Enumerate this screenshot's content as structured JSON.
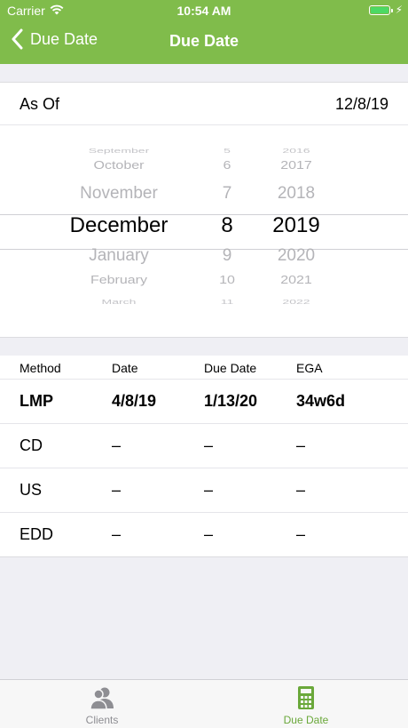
{
  "status": {
    "carrier": "Carrier",
    "time": "10:54 AM"
  },
  "nav": {
    "back_label": "Due Date",
    "title": "Due Date"
  },
  "as_of": {
    "label": "As Of",
    "value": "12/8/19"
  },
  "picker": {
    "months": [
      "",
      "September",
      "October",
      "November",
      "December",
      "January",
      "February",
      "March",
      ""
    ],
    "days": [
      "",
      "5",
      "6",
      "7",
      "8",
      "9",
      "10",
      "11",
      ""
    ],
    "years": [
      "",
      "2016",
      "2017",
      "2018",
      "2019",
      "2020",
      "2021",
      "2022",
      ""
    ],
    "selected": {
      "month": "December",
      "day": "8",
      "year": "2019"
    }
  },
  "table": {
    "headers": [
      "Method",
      "Date",
      "Due Date",
      "EGA"
    ],
    "rows": [
      [
        "LMP",
        "4/8/19",
        "1/13/20",
        "34w6d"
      ],
      [
        "CD",
        "–",
        "–",
        "–"
      ],
      [
        "US",
        "–",
        "–",
        "–"
      ],
      [
        "EDD",
        "–",
        "–",
        "–"
      ]
    ]
  },
  "tabbar": {
    "clients_label": "Clients",
    "duedate_label": "Due Date"
  },
  "colors": {
    "nav_green": "#80bc4b",
    "tab_active": "#6aa83a",
    "tab_inactive": "#8e8e93"
  }
}
